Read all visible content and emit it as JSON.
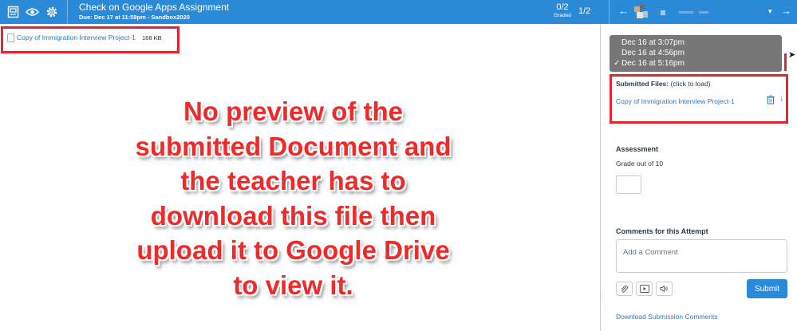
{
  "header": {
    "title": "Check on Google Apps Assignment",
    "due": "Due: Dec 17 at 11:59pm - Sandbox2020",
    "graded_value": "0/2",
    "graded_label": "Graded",
    "student_count": "1/2",
    "prev_arrow": "←",
    "next_arrow": "→",
    "dropdown_caret": "▾",
    "icons": [
      "gradebook-icon",
      "eye-icon",
      "gear-icon"
    ]
  },
  "preview": {
    "file_link": "Copy of Immigration Interview Project-1",
    "file_size": "168 KB"
  },
  "annotation": {
    "lines": [
      "No preview of the",
      "submitted Document and",
      "the teacher has to",
      "download this file then",
      "upload it to Google Drive",
      "to view it."
    ],
    "color": "#ee2a2a"
  },
  "sidebar": {
    "attempts": {
      "options": [
        "Dec 16 at 3:07pm",
        "Dec 16 at 4:56pm",
        "Dec 16 at 5:16pm"
      ],
      "selected": "Dec 16 at 5:16pm",
      "checkmark": "✓"
    },
    "submitted_files": {
      "label": "Submitted Files:",
      "hint": "(click to load)",
      "file": "Copy of Immigration Interview Project-1"
    },
    "assessment": {
      "heading": "Assessment",
      "grade_out_of": "Grade out of 10",
      "grade_value": ""
    },
    "comments": {
      "heading": "Comments for this Attempt",
      "placeholder": "Add a Comment",
      "submit_label": "Submit",
      "download_link": "Download Submission Comments"
    }
  },
  "colors": {
    "topbar": "#2b8ad7",
    "link": "#2b7abc",
    "highlight": "#e0252e",
    "dropdown_bg": "#777777"
  }
}
